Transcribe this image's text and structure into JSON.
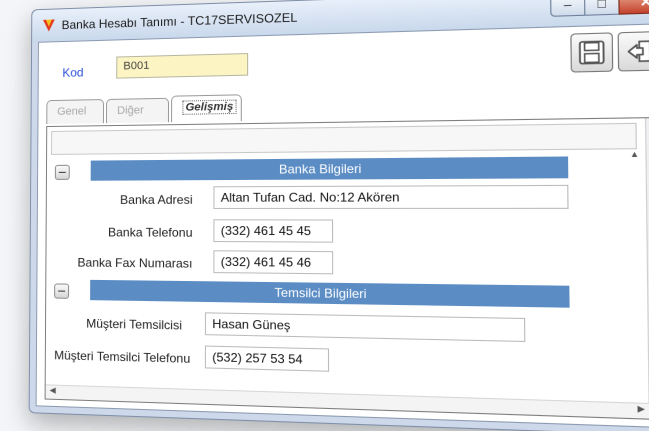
{
  "window": {
    "title": "Banka Hesabı Tanımı - TC17SERVISOZEL",
    "controls": {
      "minimize": "–",
      "maximize": "□",
      "close": "✕"
    }
  },
  "header": {
    "kod_label": "Kod",
    "kod_value": "B001"
  },
  "toolbar": {
    "save_icon": "floppy-disk-icon",
    "exit_icon": "exit-door-icon"
  },
  "tabs": [
    {
      "label": "Genel",
      "active": false
    },
    {
      "label": "Diğer",
      "active": false
    },
    {
      "label": "Gelişmiş",
      "active": true
    }
  ],
  "sections": {
    "bank": {
      "title": "Banka Bilgileri",
      "address_label": "Banka Adresi",
      "address_value": "Altan Tufan Cad. No:12 Akören",
      "phone_label": "Banka Telefonu",
      "phone_value": "(332) 461 45 45",
      "fax_label": "Banka Fax Numarası",
      "fax_value": "(332) 461 45 46"
    },
    "rep": {
      "title": "Temsilci Bilgileri",
      "name_label": "Müşteri Temsilcisi",
      "name_value": "Hasan Güneş",
      "phone_label": "Müşteri Temsilci Telefonu",
      "phone_value": "(532) 257 53 54"
    }
  },
  "colors": {
    "band": "#5b8dc4",
    "kod_field": "#fdf4c3",
    "kod_label": "#2a4fd6"
  }
}
